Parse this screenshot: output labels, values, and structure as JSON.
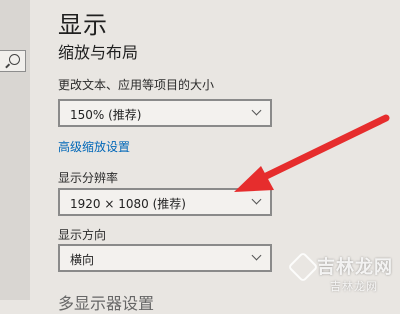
{
  "page": {
    "title": "显示",
    "section_title": "缩放与布局",
    "bottom_partial": "多显示器设置"
  },
  "scale": {
    "label": "更改文本、应用等项目的大小",
    "value": "150% (推荐)"
  },
  "advanced_link": "高级缩放设置",
  "resolution": {
    "label": "显示分辨率",
    "value": "1920 × 1080 (推荐)"
  },
  "orientation": {
    "label": "显示方向",
    "value": "横向"
  },
  "watermark": {
    "main": "吉林龙网",
    "sub": "吉林龙网"
  },
  "colors": {
    "background": "#e9e6e2",
    "accent_link": "#0067b8",
    "annotation_arrow": "#e62d2d"
  },
  "icons": {
    "search": "search-icon",
    "dropdown": "chevron-down-icon"
  }
}
